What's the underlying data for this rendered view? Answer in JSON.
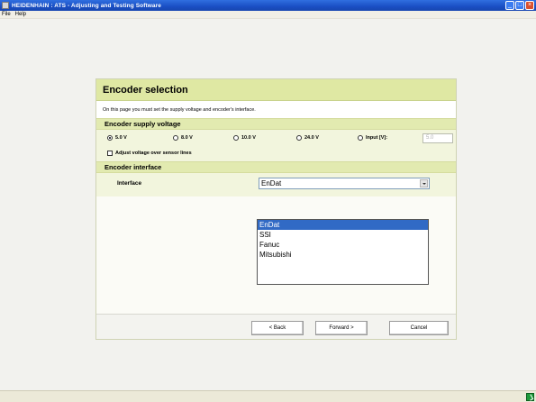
{
  "window": {
    "title": "HEIDENHAIN : ATS - Adjusting and Testing Software",
    "min_glyph": "_",
    "max_glyph": "□",
    "close_glyph": "×"
  },
  "menu": [
    "File",
    "Help"
  ],
  "panel": {
    "title": "Encoder selection",
    "description": "On this page you must set the supply voltage and encoder's interface."
  },
  "supply": {
    "heading": "Encoder supply voltage",
    "options": [
      {
        "label": "5.0 V",
        "selected": true
      },
      {
        "label": "8.0 V",
        "selected": false
      },
      {
        "label": "10.0 V",
        "selected": false
      },
      {
        "label": "24.0 V",
        "selected": false
      },
      {
        "label": "Input [V]:",
        "selected": false
      }
    ],
    "input_value": "5.0",
    "adjust_label": "Adjust voltage over sensor lines",
    "adjust_checked": false
  },
  "interface": {
    "heading": "Encoder interface",
    "label": "Interface",
    "selected": "EnDat",
    "options": [
      "EnDat",
      "SSI",
      "Fanuc",
      "Mitsubishi"
    ]
  },
  "footer": {
    "back": "< Back",
    "forward": "Forward >",
    "cancel": "Cancel"
  },
  "colors": {
    "titlebar": "#1a4fc4",
    "panel_header": "#dfe8a3",
    "section_head": "#e2eab0",
    "selection": "#316ac5"
  }
}
